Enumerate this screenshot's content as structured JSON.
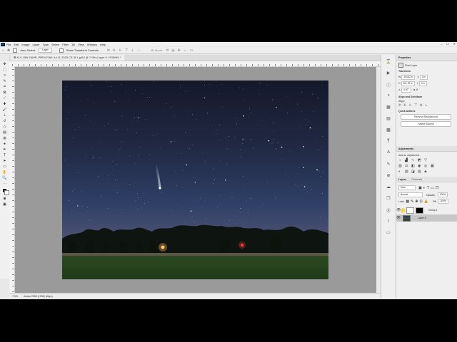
{
  "menu": {
    "app_icon": "Ps",
    "items": [
      "File",
      "Edit",
      "Image",
      "Layer",
      "Type",
      "Select",
      "Filter",
      "3D",
      "View",
      "Window",
      "Help"
    ]
  },
  "window_controls": [
    "–",
    "☐",
    "✕"
  ],
  "options_bar": {
    "auto_select_label": "Auto-Select:",
    "auto_select_value": "Layer",
    "transform_label": "Show Transform Controls",
    "mode_3d_label": "3D Mode:"
  },
  "document": {
    "tab_title": "⊠ KLV-15N ZAMP_PREV2165 Jul 11 2020-C3-30 I-jpS4 @ 7.9% (Layer 0, RGB/8*) *"
  },
  "status": {
    "zoom": "7.9%",
    "profile": "Adobe RGB (1998) (8bpc)"
  },
  "panels": {
    "properties": {
      "tab": "Properties",
      "layer_type": "Pixel Layer",
      "transform_title": "Transform",
      "w_label": "W",
      "w_value": "393.82 in",
      "h_label": "H",
      "h_value": "261.99 in",
      "x_label": "X",
      "x_value": "0 in",
      "y_label": "Y",
      "y_value": "0 in",
      "angle_value": "0.00°",
      "align_title": "Align and Distribute",
      "align_label": "Align:",
      "quick_actions_title": "Quick Actions",
      "remove_bg": "Remove Background",
      "select_subject": "Select Subject"
    },
    "adjustments": {
      "tab": "Adjustments",
      "hint": "Add an adjustment"
    },
    "layers": {
      "tab": "Layers",
      "tab2": "Channels",
      "kind_label": "Kind",
      "blend_mode": "Normal",
      "opacity_label": "Opacity:",
      "opacity_value": "100%",
      "lock_label": "Lock:",
      "fill_label": "Fill:",
      "fill_value": "100%",
      "items": [
        {
          "name": "Group 1"
        },
        {
          "name": "Layer 0"
        }
      ]
    }
  },
  "colors": {
    "accent": "#1473e6",
    "selected_layer": "#c7c7c7",
    "cursor_highlight": "#f2d34a"
  }
}
